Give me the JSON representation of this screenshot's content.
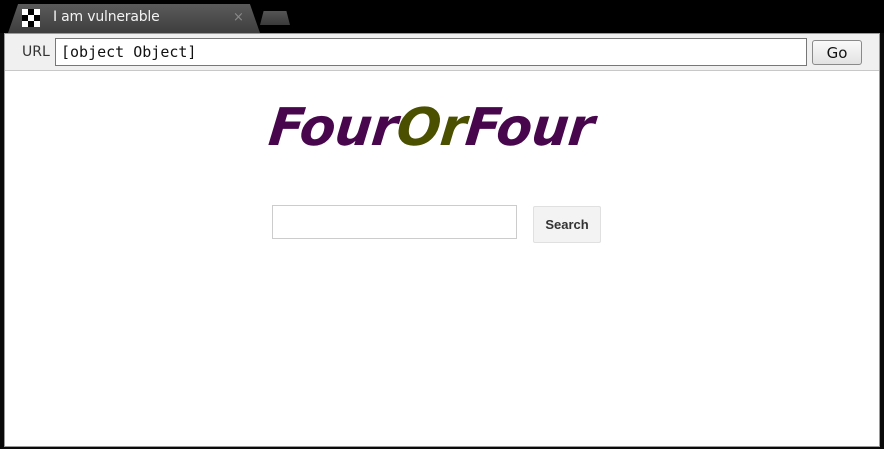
{
  "tab": {
    "title": "I am vulnerable",
    "close_glyph": "×",
    "favicon": "checkerboard-icon"
  },
  "urlbar": {
    "label": "URL",
    "value": "[object Object]",
    "go_label": "Go"
  },
  "page": {
    "logo": {
      "parts": [
        "Four",
        "Or",
        "Four"
      ],
      "colors": [
        "#48064d",
        "#4a5000",
        "#48064d"
      ]
    },
    "search": {
      "value": "",
      "button_label": "Search"
    }
  }
}
